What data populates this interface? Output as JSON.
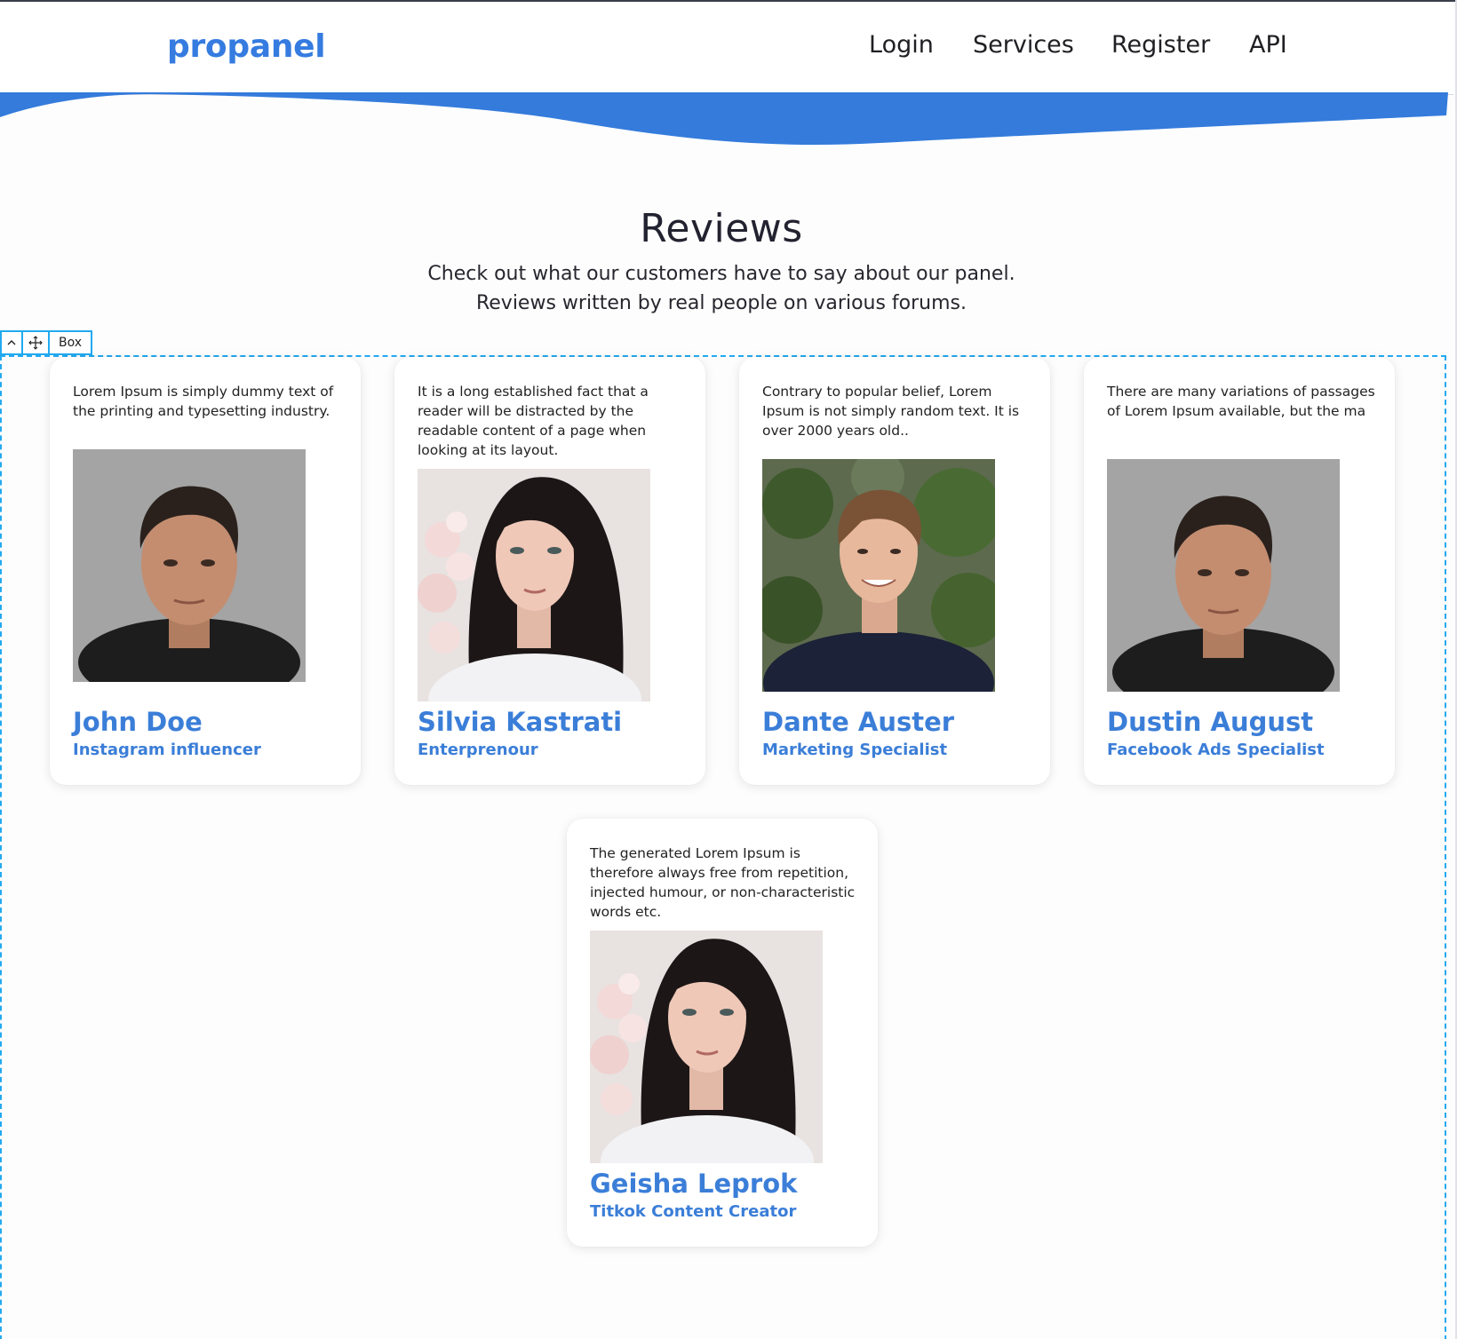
{
  "header": {
    "logo": "propanel",
    "nav": [
      "Login",
      "Services",
      "Register",
      "API"
    ]
  },
  "reviews": {
    "title": "Reviews",
    "subtitle_line1": "Check out what our customers have to say about our panel.",
    "subtitle_line2": "Reviews written by real people on various forums."
  },
  "editor_toolbar": {
    "icons": [
      "chevron-up-icon",
      "move-icon"
    ],
    "label": "Box"
  },
  "cards": [
    {
      "quote": "Lorem Ipsum is simply dummy text of the printing and typesetting industry.",
      "name": "John Doe",
      "role": "Instagram influencer",
      "photo": "man-gray-background"
    },
    {
      "quote": "It is a long established fact that a reader will be distracted by the readable content of a page when looking at its layout.",
      "name": "Silvia Kastrati",
      "role": "Enterprenour",
      "photo": "woman-dark-hair-blossoms"
    },
    {
      "quote": "Contrary to popular belief, Lorem Ipsum is not simply random text. It is over 2000 years old..",
      "name": "Dante Auster",
      "role": "Marketing Specialist",
      "photo": "man-smiling-plants"
    },
    {
      "quote": "There are many variations of passages of Lorem Ipsum available, but the ma",
      "name": "Dustin August",
      "role": "Facebook Ads Specialist",
      "photo": "man-gray-background"
    },
    {
      "quote": "The generated Lorem Ipsum is therefore always free from repetition, injected humour, or non-characteristic words etc.",
      "name": "Geisha Leprok",
      "role": "Titkok Content Creator",
      "photo": "woman-dark-hair-blossoms"
    }
  ],
  "colors": {
    "brand_blue": "#357be0",
    "wave_blue": "#347bdc",
    "selection_outline": "#22a9f0"
  }
}
